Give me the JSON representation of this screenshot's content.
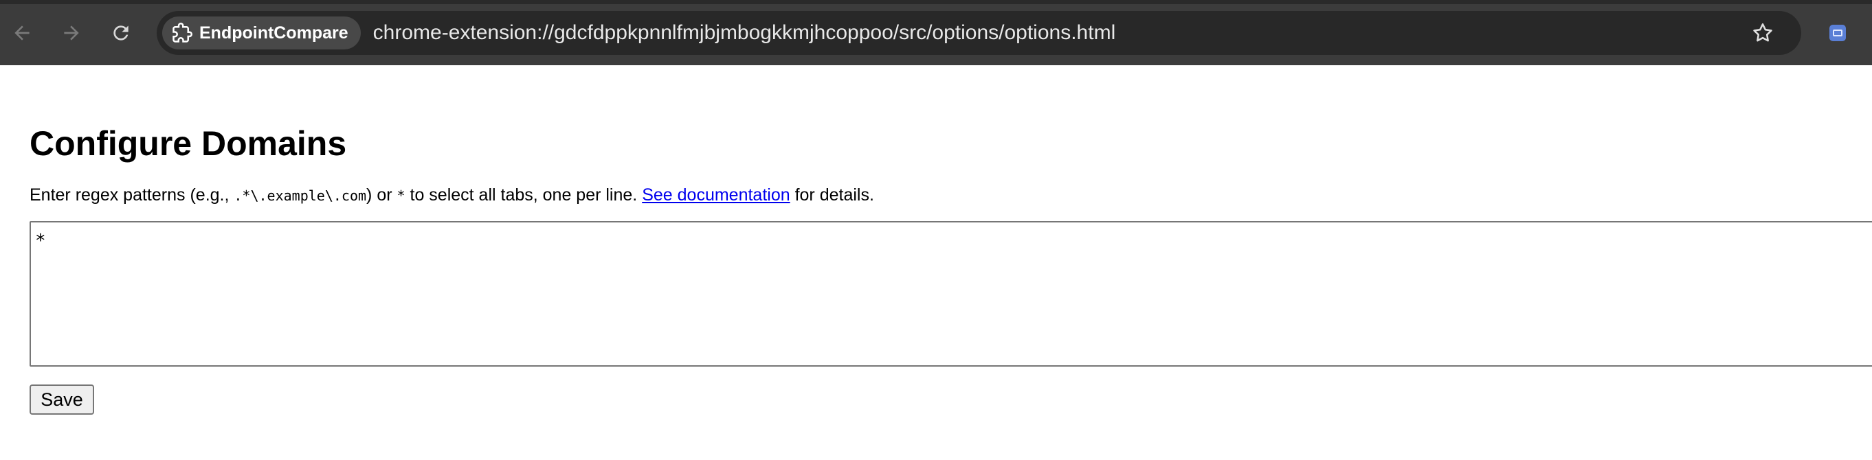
{
  "browser": {
    "extension_chip_label": "EndpointCompare",
    "url": "chrome-extension://gdcfdppkpnnlfmjbjmbogkkmjhcoppoo/src/options/options.html",
    "icons": [
      "back-arrow-icon",
      "forward-arrow-icon",
      "reload-icon",
      "puzzle-piece-icon",
      "star-icon",
      "extension-icon"
    ]
  },
  "page": {
    "title": "Configure Domains",
    "instructions": {
      "prefix": "Enter regex patterns (e.g., ",
      "example_code": ".*\\.example\\.com",
      "middle": ") or ",
      "wildcard_code": "*",
      "suffix": " to select all tabs, one per line. ",
      "link_text": "See documentation",
      "after_link": " for details."
    },
    "domains_textarea_value": "*",
    "save_button_label": "Save"
  },
  "colors": {
    "toolbar": "#3c3c3c",
    "omnibox": "#282828",
    "link": "#0000ee"
  }
}
